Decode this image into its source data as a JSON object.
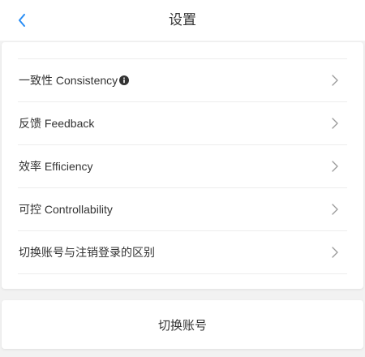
{
  "header": {
    "title": "设置",
    "back_icon": "chevron-left-icon",
    "accent_color": "#2a8ef5"
  },
  "settings": {
    "items": [
      {
        "label": "一致性 Consistency",
        "has_info": true
      },
      {
        "label": "反馈 Feedback",
        "has_info": false
      },
      {
        "label": "效率 Efficiency",
        "has_info": false
      },
      {
        "label": "可控 Controllability",
        "has_info": false
      },
      {
        "label": "切换账号与注销登录的区别",
        "has_info": false
      }
    ]
  },
  "footer": {
    "switch_account_label": "切换账号"
  }
}
